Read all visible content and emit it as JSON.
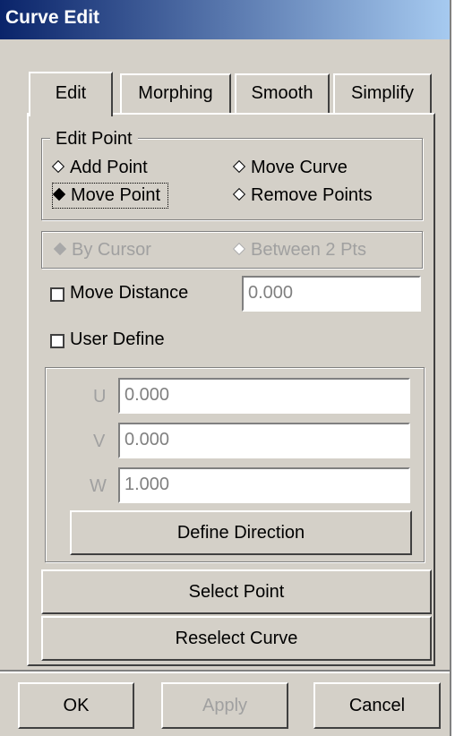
{
  "window": {
    "title": "Curve Edit"
  },
  "tabs": [
    {
      "label": "Edit",
      "active": true
    },
    {
      "label": "Morphing",
      "active": false
    },
    {
      "label": "Smooth",
      "active": false
    },
    {
      "label": "Simplify",
      "active": false
    }
  ],
  "edit_point": {
    "legend": "Edit Point",
    "options": [
      {
        "label": "Add Point",
        "selected": false
      },
      {
        "label": "Move Curve",
        "selected": false
      },
      {
        "label": "Move Point",
        "selected": true
      },
      {
        "label": "Remove Points",
        "selected": false
      }
    ]
  },
  "mode": {
    "options": [
      {
        "label": "By Cursor",
        "selected": true,
        "enabled": false
      },
      {
        "label": "Between 2 Pts",
        "selected": false,
        "enabled": false
      }
    ]
  },
  "move_distance": {
    "label": "Move Distance",
    "checked": false,
    "value": "0.000"
  },
  "user_define": {
    "label": "User Define",
    "checked": false,
    "u_label": "U",
    "u_value": "0.000",
    "v_label": "V",
    "v_value": "0.000",
    "w_label": "W",
    "w_value": "1.000",
    "define_direction": "Define Direction"
  },
  "buttons": {
    "select_point": "Select Point",
    "reselect_curve": "Reselect Curve",
    "ok": "OK",
    "apply": "Apply",
    "cancel": "Cancel"
  },
  "colors": {
    "titlebar_start": "#0a246a",
    "titlebar_end": "#a6caf0",
    "face": "#d4d0c8",
    "disabled_text": "#a0a0a0"
  }
}
